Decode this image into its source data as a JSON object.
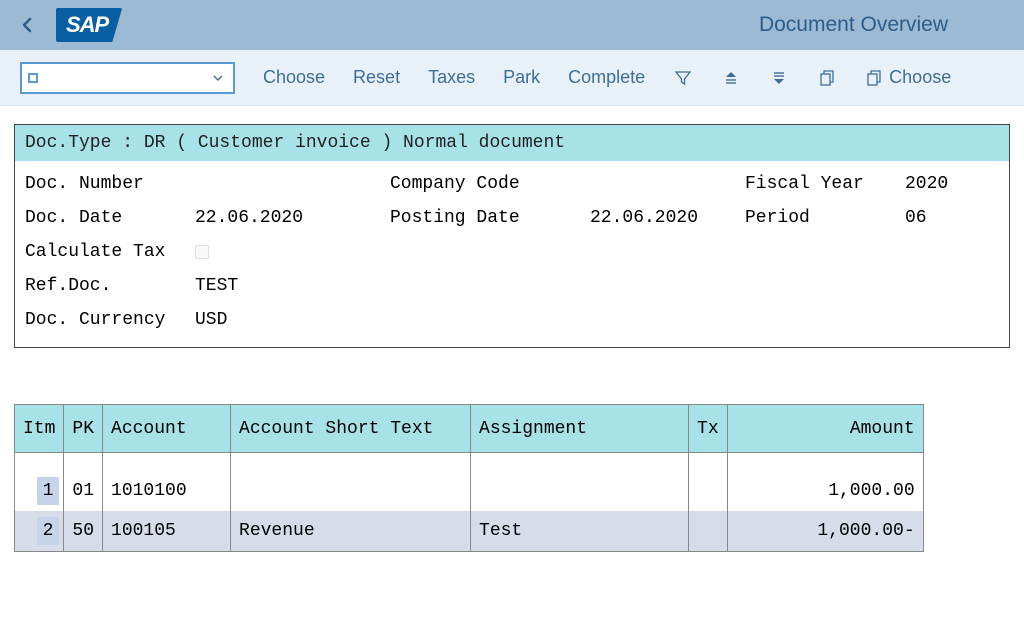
{
  "header": {
    "logo_text": "SAP",
    "page_title": "Document Overview"
  },
  "toolbar": {
    "combo_value": "",
    "choose": "Choose",
    "reset": "Reset",
    "taxes": "Taxes",
    "park": "Park",
    "complete": "Complete",
    "choose2": "Choose"
  },
  "doc": {
    "type_line": "Doc.Type : DR ( Customer invoice ) Normal document",
    "labels": {
      "number": "Doc. Number",
      "company_code": "Company Code",
      "fiscal_year": "Fiscal Year",
      "date": "Doc. Date",
      "posting_date": "Posting Date",
      "period": "Period",
      "calc_tax": "Calculate Tax",
      "ref_doc": "Ref.Doc.",
      "currency": "Doc. Currency"
    },
    "values": {
      "number": "",
      "company_code": "",
      "fiscal_year": "2020",
      "date": "22.06.2020",
      "posting_date": "22.06.2020",
      "period": "06",
      "ref_doc": "TEST",
      "currency": "USD"
    }
  },
  "table": {
    "headers": {
      "itm": "Itm",
      "pk": "PK",
      "account": "Account",
      "short_text": "Account Short Text",
      "assignment": "Assignment",
      "tx": "Tx",
      "amount": "Amount"
    },
    "rows": [
      {
        "itm": "1",
        "pk": "01",
        "account": "1010100",
        "short_text": "",
        "assignment": "",
        "tx": "",
        "amount": "1,000.00"
      },
      {
        "itm": "2",
        "pk": "50",
        "account": "100105",
        "short_text": "Revenue",
        "assignment": "Test",
        "tx": "",
        "amount": "1,000.00-"
      }
    ]
  }
}
